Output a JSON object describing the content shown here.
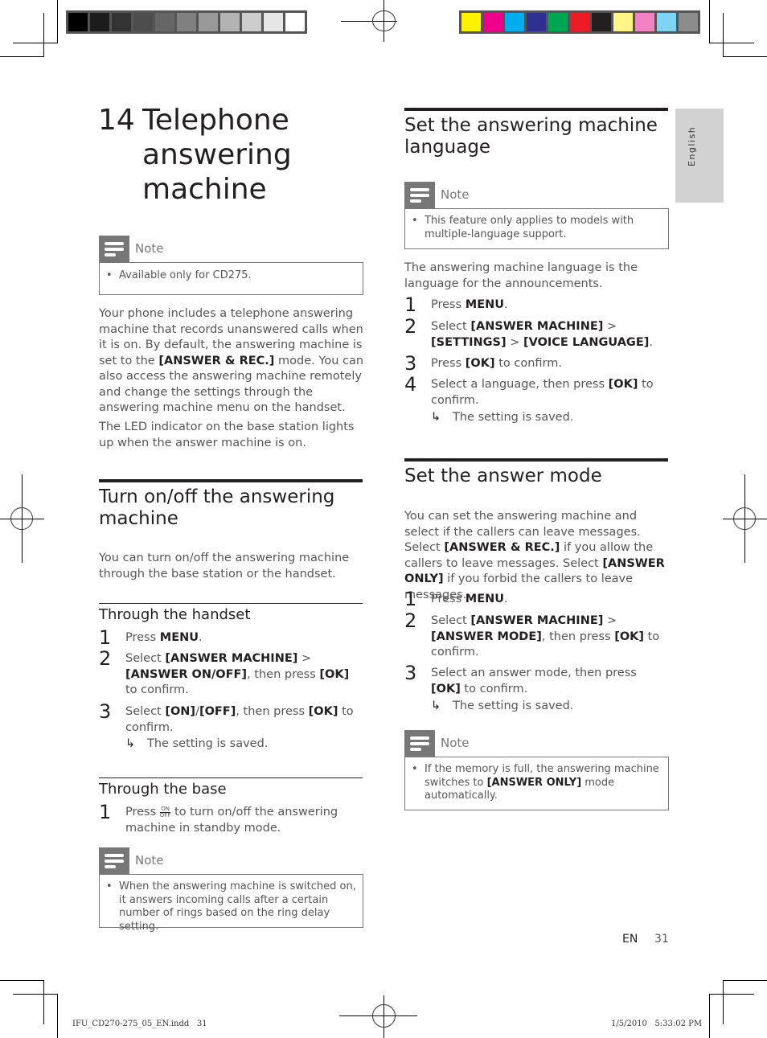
{
  "print_marks": {
    "gray_swatches": [
      "#000000",
      "#1c1c1c",
      "#333333",
      "#4d4d4d",
      "#666666",
      "#808080",
      "#999999",
      "#b3b3b3",
      "#cccccc",
      "#e6e6e6",
      "#ffffff"
    ],
    "color_swatches": [
      "#fff200",
      "#ec008c",
      "#00aeef",
      "#2e3192",
      "#00a651",
      "#ed1c24",
      "#231f20",
      "#fff685",
      "#f283c3",
      "#7dd4f5",
      "#8c8c8c"
    ],
    "slug_file": "IFU_CD270-275_05_EN.indd   31",
    "slug_date": "1/5/2010   5:33:02 PM"
  },
  "side_tab": {
    "label": "English"
  },
  "chapter": {
    "number": "14",
    "title": "Telephone answering machine"
  },
  "note_label": "Note",
  "left": {
    "note1": {
      "text": "Available only for CD275."
    },
    "intro": {
      "p1_a": "Your phone includes a telephone answering machine that records unanswered calls when it is on. By default, the answering machine is set to the ",
      "p1_b": "[ANSWER & REC.]",
      "p1_c": " mode. You can also access the answering machine remotely and change the settings through the answering machine menu on the handset.",
      "p2": "The LED indicator on the base station lights up when the answer machine is on."
    },
    "section_turn": {
      "title": "Turn on/off the answering machine",
      "desc": "You can turn on/off the answering machine through the base station or the handset."
    },
    "handset": {
      "title": "Through the handset",
      "steps": [
        {
          "n": "1",
          "a": "Press ",
          "b": "MENU",
          "c": "."
        },
        {
          "n": "2",
          "a": "Select ",
          "b": "[ANSWER MACHINE]",
          "c": " > ",
          "d": "[ANSWER ON/OFF]",
          "e": ", then press ",
          "f": "[OK]",
          "g": " to confirm."
        },
        {
          "n": "3",
          "a": "Select ",
          "b": "[ON]",
          "c": "/",
          "d": "[OFF]",
          "e": ", then press ",
          "f": "[OK]",
          "g": " to confirm."
        }
      ],
      "result": "The setting is saved."
    },
    "base": {
      "title": "Through the base",
      "step_n": "1",
      "step_a": "Press ",
      "icon_on": "ON",
      "icon_off": "OFF",
      "step_b": " to turn on/off the answering machine in standby mode."
    },
    "note2": {
      "text": "When the answering machine is switched on, it answers incoming calls after a certain number of rings based on the ring delay setting."
    }
  },
  "right": {
    "language": {
      "title": "Set the answering machine language",
      "note": "This feature only applies to models with multiple-language support.",
      "desc": "The answering machine language is the language for the announcements.",
      "steps": [
        {
          "n": "1",
          "a": "Press ",
          "b": "MENU",
          "c": "."
        },
        {
          "n": "2",
          "a": "Select ",
          "b": "[ANSWER MACHINE]",
          "c": " > ",
          "d": "[SETTINGS]",
          "e": " > ",
          "f": "[VOICE LANGUAGE]",
          "g": "."
        },
        {
          "n": "3",
          "a": "Press ",
          "b": "[OK]",
          "c": " to confirm."
        },
        {
          "n": "4",
          "a": "Select a language, then press ",
          "b": "[OK]",
          "c": " to confirm."
        }
      ],
      "result": "The setting is saved."
    },
    "mode": {
      "title": "Set the answer mode",
      "desc_a": "You can set the answering machine and select if the callers can leave messages. Select ",
      "desc_b": "[ANSWER & REC.]",
      "desc_c": " if you allow the callers to leave messages. Select ",
      "desc_d": "[ANSWER ONLY]",
      "desc_e": " if you forbid the callers to leave messages.",
      "steps": [
        {
          "n": "1",
          "a": "Press ",
          "b": "MENU",
          "c": "."
        },
        {
          "n": "2",
          "a": "Select ",
          "b": "[ANSWER MACHINE]",
          "c": " > ",
          "d": "[ANSWER MODE]",
          "e": ", then press ",
          "f": "[OK]",
          "g": " to confirm."
        },
        {
          "n": "3",
          "a": "Select an answer mode, then press ",
          "b": "[OK]",
          "c": " to confirm."
        }
      ],
      "result": "The setting is saved.",
      "note_a": "If the memory is full, the answering machine switches to ",
      "note_b": "[ANSWER ONLY]",
      "note_c": " mode automatically."
    }
  },
  "footer": {
    "lang": "EN",
    "page": "31"
  }
}
